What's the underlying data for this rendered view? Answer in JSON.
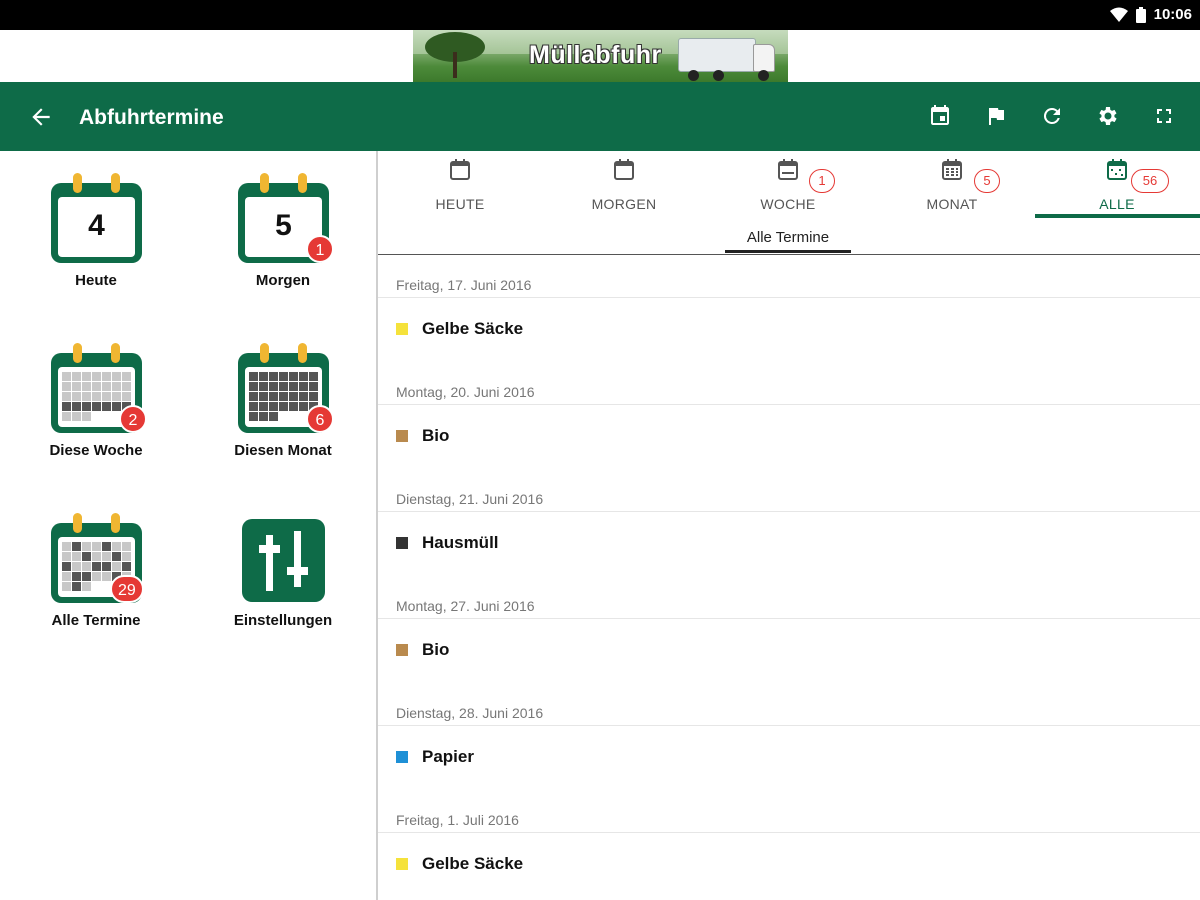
{
  "statusbar": {
    "time": "10:06"
  },
  "banner": {
    "title": "Müllabfuhr"
  },
  "toolbar": {
    "title": "Abfuhrtermine",
    "actions": [
      "event-icon",
      "flag-icon",
      "refresh-icon",
      "settings-icon",
      "fullscreen-icon"
    ]
  },
  "tiles": [
    {
      "label": "Heute",
      "number": "4",
      "badge": ""
    },
    {
      "label": "Morgen",
      "number": "5",
      "badge": "1"
    },
    {
      "label": "Diese Woche",
      "badge": "2"
    },
    {
      "label": "Diesen Monat",
      "badge": "6"
    },
    {
      "label": "Alle Termine",
      "badge": "29"
    },
    {
      "label": "Einstellungen",
      "badge": ""
    }
  ],
  "tabs": [
    {
      "label": "HEUTE",
      "count": ""
    },
    {
      "label": "MORGEN",
      "count": ""
    },
    {
      "label": "WOCHE",
      "count": "1"
    },
    {
      "label": "MONAT",
      "count": "5"
    },
    {
      "label": "ALLE",
      "count": "56",
      "active": true
    }
  ],
  "subheader": {
    "title": "Alle Termine"
  },
  "entries": [
    {
      "date": "Freitag, 17. Juni 2016",
      "type": "Gelbe Säcke",
      "color": "#f5e23b"
    },
    {
      "date": "Montag, 20. Juni 2016",
      "type": "Bio",
      "color": "#b98a4e"
    },
    {
      "date": "Dienstag, 21. Juni 2016",
      "type": "Hausmüll",
      "color": "#333333"
    },
    {
      "date": "Montag, 27. Juni 2016",
      "type": "Bio",
      "color": "#b98a4e"
    },
    {
      "date": "Dienstag, 28. Juni 2016",
      "type": "Papier",
      "color": "#1e90d6"
    },
    {
      "date": "Freitag, 1. Juli 2016",
      "type": "Gelbe Säcke",
      "color": "#f5e23b"
    }
  ],
  "colors": {
    "primary": "#0e6b48",
    "badge": "#e53935"
  }
}
